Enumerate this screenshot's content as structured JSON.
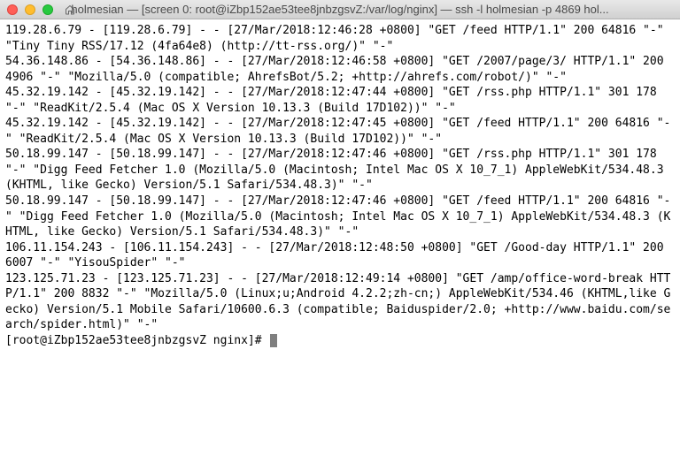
{
  "window": {
    "title": "holmesian — [screen 0: root@iZbp152ae53tee8jnbzgsvZ:/var/log/nginx] — ssh -l holmesian -p 4869 hol..."
  },
  "log_lines": [
    "119.28.6.79 - [119.28.6.79] - - [27/Mar/2018:12:46:28 +0800] \"GET /feed HTTP/1.1\" 200 64816 \"-\" \"Tiny Tiny RSS/17.12 (4fa64e8) (http://tt-rss.org/)\" \"-\"",
    "54.36.148.86 - [54.36.148.86] - - [27/Mar/2018:12:46:58 +0800] \"GET /2007/page/3/ HTTP/1.1\" 200 4906 \"-\" \"Mozilla/5.0 (compatible; AhrefsBot/5.2; +http://ahrefs.com/robot/)\" \"-\"",
    "45.32.19.142 - [45.32.19.142] - - [27/Mar/2018:12:47:44 +0800] \"GET /rss.php HTTP/1.1\" 301 178 \"-\" \"ReadKit/2.5.4 (Mac OS X Version 10.13.3 (Build 17D102))\" \"-\"",
    "45.32.19.142 - [45.32.19.142] - - [27/Mar/2018:12:47:45 +0800] \"GET /feed HTTP/1.1\" 200 64816 \"-\" \"ReadKit/2.5.4 (Mac OS X Version 10.13.3 (Build 17D102))\" \"-\"",
    "50.18.99.147 - [50.18.99.147] - - [27/Mar/2018:12:47:46 +0800] \"GET /rss.php HTTP/1.1\" 301 178 \"-\" \"Digg Feed Fetcher 1.0 (Mozilla/5.0 (Macintosh; Intel Mac OS X 10_7_1) AppleWebKit/534.48.3 (KHTML, like Gecko) Version/5.1 Safari/534.48.3)\" \"-\"",
    "50.18.99.147 - [50.18.99.147] - - [27/Mar/2018:12:47:46 +0800] \"GET /feed HTTP/1.1\" 200 64816 \"-\" \"Digg Feed Fetcher 1.0 (Mozilla/5.0 (Macintosh; Intel Mac OS X 10_7_1) AppleWebKit/534.48.3 (KHTML, like Gecko) Version/5.1 Safari/534.48.3)\" \"-\"",
    "106.11.154.243 - [106.11.154.243] - - [27/Mar/2018:12:48:50 +0800] \"GET /Good-day HTTP/1.1\" 200 6007 \"-\" \"YisouSpider\" \"-\"",
    "123.125.71.23 - [123.125.71.23] - - [27/Mar/2018:12:49:14 +0800] \"GET /amp/office-word-break HTTP/1.1\" 200 8832 \"-\" \"Mozilla/5.0 (Linux;u;Android 4.2.2;zh-cn;) AppleWebKit/534.46 (KHTML,like Gecko) Version/5.1 Mobile Safari/10600.6.3 (compatible; Baiduspider/2.0; +http://www.baidu.com/search/spider.html)\" \"-\""
  ],
  "prompt": "[root@iZbp152ae53tee8jnbzgsvZ nginx]# "
}
